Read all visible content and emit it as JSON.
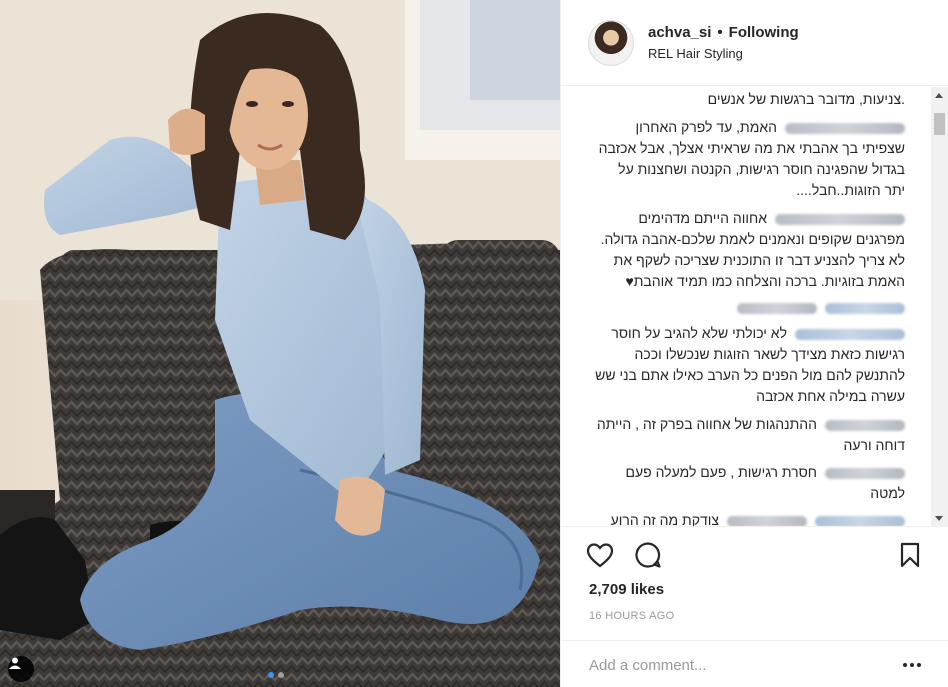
{
  "header": {
    "username": "achva_si",
    "separator": "•",
    "follow_status": "Following",
    "location": "REL Hair Styling"
  },
  "comments": [
    {
      "username_blurred": false,
      "text": ".צניעות, מדובר ברגשות של אנשים"
    },
    {
      "username_blurred": true,
      "text": "האמת, עד לפרק האחרון שצפיתי בך אהבתי את מה שראיתי אצלך, אבל אכזבה בגדול שהפגינה חוסר רגישות, הקנטה ושחצנות על יתר הזוגות..חבל...."
    },
    {
      "username_blurred": true,
      "text": "אחווה הייתם מדהימים מפרגנים שקופים ונאמנים לאמת שלכם-אהבה גדולה. לא צריך להצניע דבר זו התוכנית שצריכה לשקף את האמת בזוגיות. ברכה והצלחה כמו תמיד אוהבת♥"
    },
    {
      "username_blurred": true,
      "text": ""
    },
    {
      "username_blurred": true,
      "text": "לא יכולתי שלא להגיב על חוסר רגישות כזאת מצידך לשאר הזוגות שנכשלו וככה להתנשק להם מול הפנים כל הערב כאילו אתם בני שש עשרה במילה אחת אכזבה"
    },
    {
      "username_blurred": true,
      "text": "ההתנהגות של אחווה בפרק זה , הייתה דוחה ורעה"
    },
    {
      "username_blurred": true,
      "text": "חסרת רגישות , פעם למעלה פעם למטה"
    },
    {
      "username_blurred": true,
      "text": "צודקת מה זה הרוע"
    }
  ],
  "actions": {
    "like_icon": "heart-icon",
    "comment_icon": "speech-bubble-icon",
    "save_icon": "bookmark-icon"
  },
  "likes": "2,709 likes",
  "timestamp": "16 HOURS AGO",
  "comment_input": {
    "placeholder": "Add a comment...",
    "value": ""
  },
  "more_icon": "more-options-icon",
  "colors": {
    "accent": "#3897f0",
    "text": "#262626",
    "muted": "#999999",
    "border": "#efefef"
  }
}
